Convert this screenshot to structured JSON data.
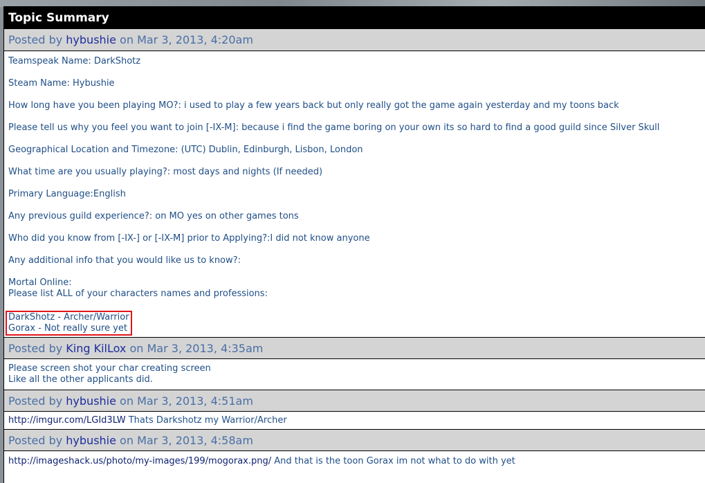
{
  "title": "Topic Summary",
  "posts": [
    {
      "prefix": "Posted by",
      "author": "hybushie",
      "date": "on Mar 3, 2013, 4:20am",
      "lines": [
        "Teamspeak Name: DarkShotz",
        "Steam Name: Hybushie",
        "How long have you been playing MO?: i used to play a few years back but only really got the game again yesterday and my toons back",
        "Please tell us why you feel you want to join [-IX-M]: because i find the game boring on your own its so hard to find a good guild since Silver Skull",
        "Geographical Location and Timezone: (UTC) Dublin, Edinburgh, Lisbon, London",
        "What time are you usually playing?: most days and nights (If needed)",
        "Primary Language:English",
        "Any previous guild experience?: on MO yes on other games tons",
        "Who did you know from [-IX-] or [-IX-M] prior to Applying?:I did not know anyone",
        "Any additional info that you would like us to know?:",
        "Mortal Online:",
        "Please list ALL of your characters names and professions:"
      ],
      "characters": [
        "DarkShotz - Archer/Warrior",
        "Gorax - Not really sure yet"
      ]
    },
    {
      "prefix": "Posted by",
      "author": "King KilLox",
      "date": "on Mar 3, 2013, 4:35am",
      "lines": [
        "Please screen shot your char creating screen",
        "Like all the other applicants did."
      ]
    },
    {
      "prefix": "Posted by",
      "author": "hybushie",
      "date": "on Mar 3, 2013, 4:51am",
      "link": "http://imgur.com/LGId3LW",
      "text": " Thats Darkshotz my Warrior/Archer"
    },
    {
      "prefix": "Posted by",
      "author": "hybushie",
      "date": "on Mar 3, 2013, 4:58am",
      "link": "http://imageshack.us/photo/my-images/199/mogorax.png/",
      "text": " And that is the toon Gorax im not what to do with yet"
    }
  ]
}
